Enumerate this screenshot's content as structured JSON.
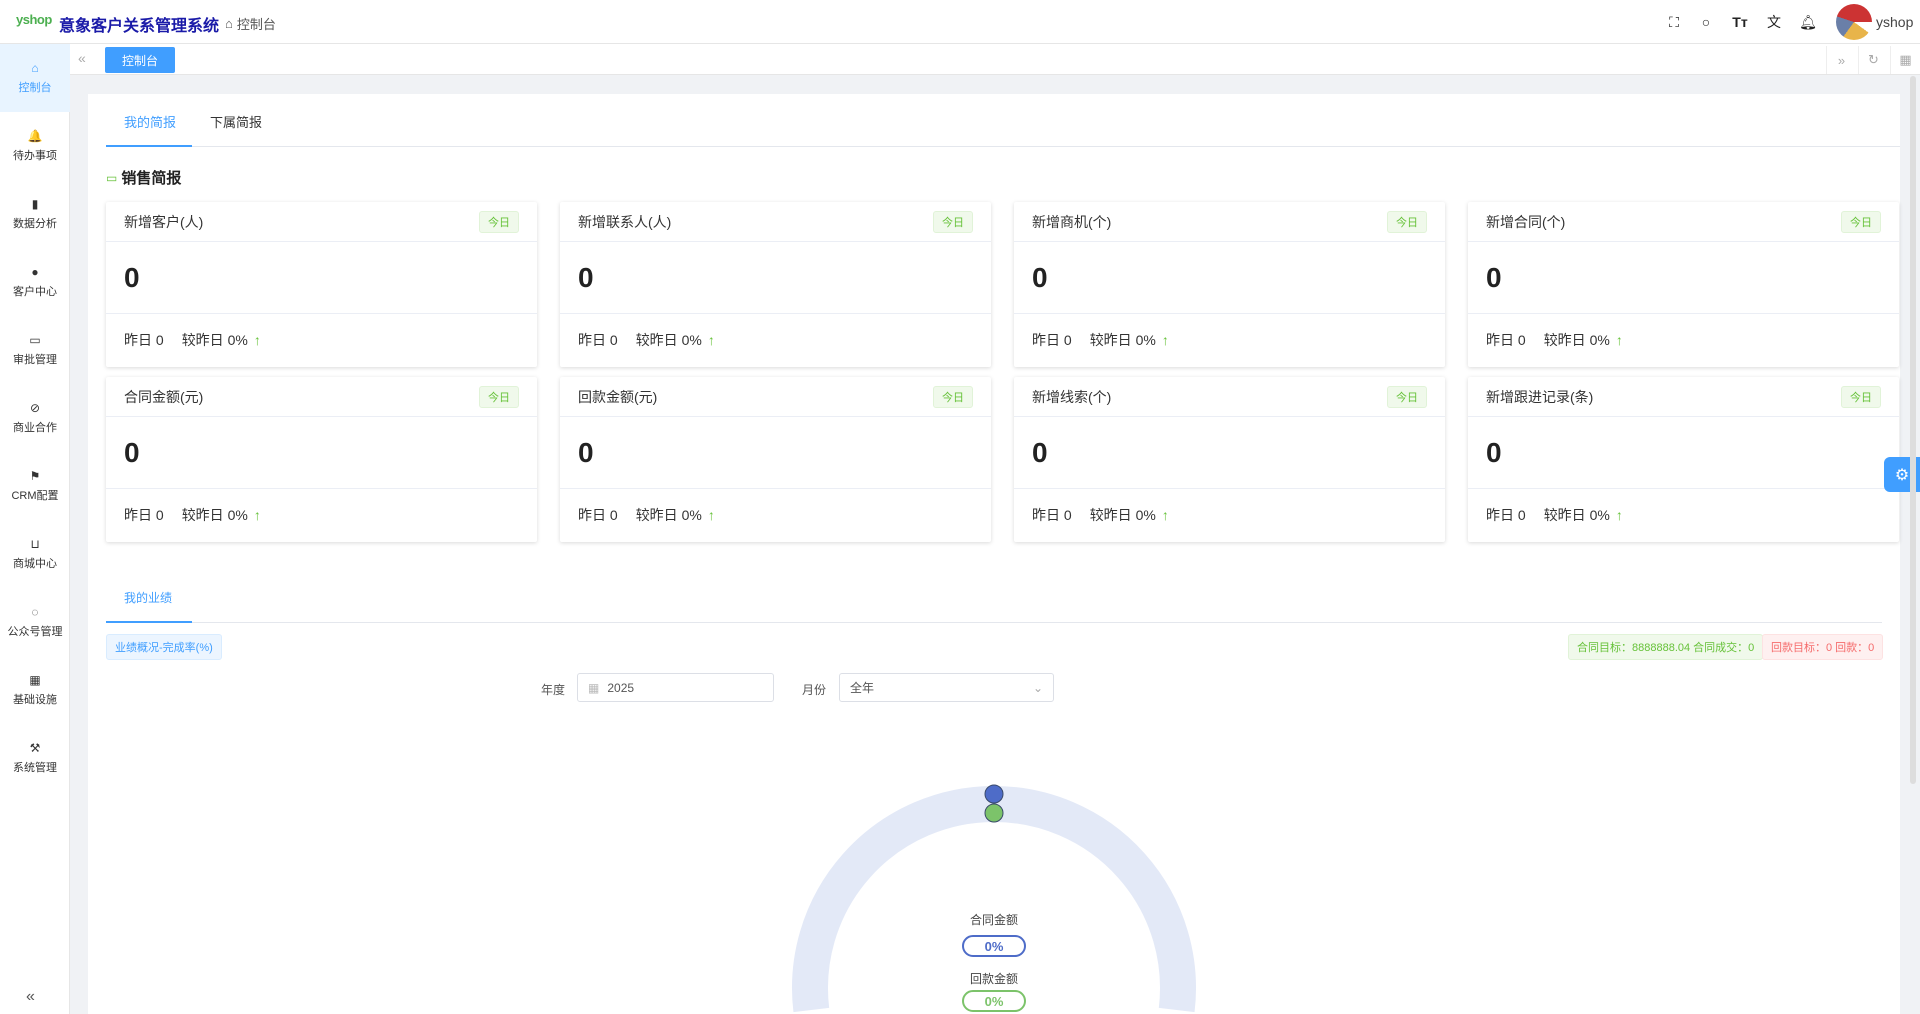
{
  "header": {
    "logo": "yshop",
    "app_title": "意象客户关系管理系统",
    "breadcrumb": "控制台",
    "user": "yshop"
  },
  "sidebar": {
    "items": [
      {
        "label": "控制台",
        "icon": "home-icon",
        "glyph": "⌂"
      },
      {
        "label": "待办事项",
        "icon": "bell-icon",
        "glyph": "🔔"
      },
      {
        "label": "数据分析",
        "icon": "bar-chart-icon",
        "glyph": "▮"
      },
      {
        "label": "客户中心",
        "icon": "user-icon",
        "glyph": "●"
      },
      {
        "label": "审批管理",
        "icon": "folder-check-icon",
        "glyph": "▭"
      },
      {
        "label": "商业合作",
        "icon": "link-icon",
        "glyph": "⊘"
      },
      {
        "label": "CRM配置",
        "icon": "flag-icon",
        "glyph": "⚑"
      },
      {
        "label": "商城中心",
        "icon": "cart-icon",
        "glyph": "⊔"
      },
      {
        "label": "公众号管理",
        "icon": "chat-icon",
        "glyph": "◌"
      },
      {
        "label": "基础设施",
        "icon": "grid-icon",
        "glyph": "▦"
      },
      {
        "label": "系统管理",
        "icon": "hammer-icon",
        "glyph": "⚒"
      }
    ]
  },
  "tabs": {
    "active": "控制台"
  },
  "brief": {
    "tabs": [
      "我的简报",
      "下属简报"
    ],
    "section_title": "销售简报",
    "cards": [
      {
        "title": "新增客户(人)",
        "tag": "今日",
        "value": "0",
        "yesterday": "昨日 0",
        "compare": "较昨日 0%"
      },
      {
        "title": "新增联系人(人)",
        "tag": "今日",
        "value": "0",
        "yesterday": "昨日 0",
        "compare": "较昨日 0%"
      },
      {
        "title": "新增商机(个)",
        "tag": "今日",
        "value": "0",
        "yesterday": "昨日 0",
        "compare": "较昨日 0%"
      },
      {
        "title": "新增合同(个)",
        "tag": "今日",
        "value": "0",
        "yesterday": "昨日 0",
        "compare": "较昨日 0%"
      },
      {
        "title": "合同金额(元)",
        "tag": "今日",
        "value": "0",
        "yesterday": "昨日 0",
        "compare": "较昨日 0%"
      },
      {
        "title": "回款金额(元)",
        "tag": "今日",
        "value": "0",
        "yesterday": "昨日 0",
        "compare": "较昨日 0%"
      },
      {
        "title": "新增线索(个)",
        "tag": "今日",
        "value": "0",
        "yesterday": "昨日 0",
        "compare": "较昨日 0%"
      },
      {
        "title": "新增跟进记录(条)",
        "tag": "今日",
        "value": "0",
        "yesterday": "昨日 0",
        "compare": "较昨日 0%"
      }
    ]
  },
  "performance": {
    "tab": "我的业绩",
    "overview_tag": "业绩概况-完成率(%)",
    "contract_tag": "合同目标：8888888.04 合同成交：0",
    "payment_tag": "回款目标：0 回款：0",
    "year_label": "年度",
    "year_value": "2025",
    "month_label": "月份",
    "month_value": "全年"
  },
  "chart_data": {
    "type": "gauge",
    "series": [
      {
        "name": "合同金额",
        "value": 0,
        "label": "0%",
        "color": "#4e6cc8"
      },
      {
        "name": "回款金额",
        "value": 0,
        "label": "0%",
        "color": "#7cc36a"
      }
    ],
    "range": [
      0,
      100
    ]
  }
}
